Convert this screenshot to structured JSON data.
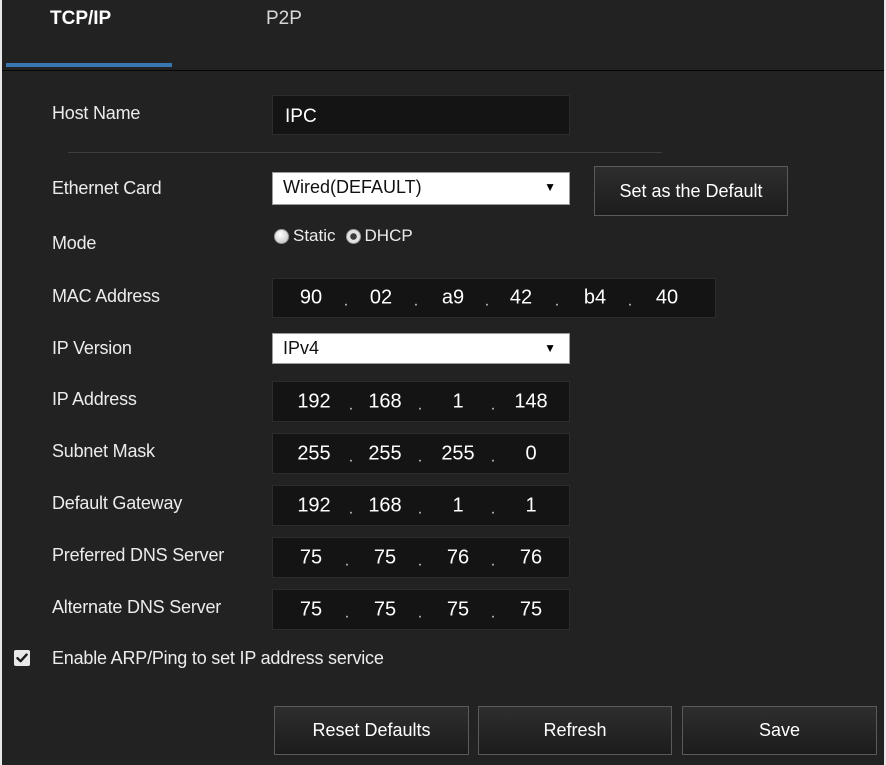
{
  "tabs": [
    {
      "label": "TCP/IP",
      "active": true
    },
    {
      "label": "P2P",
      "active": false
    }
  ],
  "form": {
    "host_name": {
      "label": "Host Name",
      "value": "IPC"
    },
    "ethernet_card": {
      "label": "Ethernet Card",
      "selected": "Wired(DEFAULT)",
      "button": "Set as the Default"
    },
    "mode": {
      "label": "Mode",
      "options": [
        "Static",
        "DHCP"
      ],
      "selected": "DHCP"
    },
    "mac_address": {
      "label": "MAC Address",
      "segments": [
        "90",
        "02",
        "a9",
        "42",
        "b4",
        "40"
      ]
    },
    "ip_version": {
      "label": "IP Version",
      "selected": "IPv4"
    },
    "ip_address": {
      "label": "IP Address",
      "segments": [
        "192",
        "168",
        "1",
        "148"
      ]
    },
    "subnet_mask": {
      "label": "Subnet Mask",
      "segments": [
        "255",
        "255",
        "255",
        "0"
      ]
    },
    "default_gateway": {
      "label": "Default Gateway",
      "segments": [
        "192",
        "168",
        "1",
        "1"
      ]
    },
    "preferred_dns": {
      "label": "Preferred DNS Server",
      "segments": [
        "75",
        "75",
        "76",
        "76"
      ]
    },
    "alternate_dns": {
      "label": "Alternate DNS Server",
      "segments": [
        "75",
        "75",
        "75",
        "75"
      ]
    },
    "arp_ping": {
      "label": "Enable ARP/Ping to set IP address service",
      "checked": true
    }
  },
  "buttons": {
    "reset": "Reset Defaults",
    "refresh": "Refresh",
    "save": "Save"
  },
  "separator": ".",
  "colors": {
    "background": "#222222",
    "field_background": "#141414",
    "tab_underline": "#3a77b0"
  },
  "icons": {
    "dropdown": "triangle-down",
    "checkbox": "checkmark"
  }
}
